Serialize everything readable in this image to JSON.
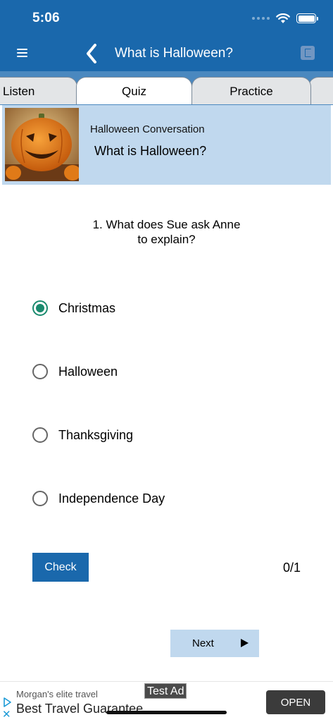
{
  "status_bar": {
    "time": "5:06"
  },
  "nav": {
    "title": "What is Halloween?",
    "icons": {
      "menu": "hamburger-menu-icon",
      "back": "chevron-left-icon",
      "bookmark": "book-icon"
    }
  },
  "tabs": [
    {
      "label": "Listen",
      "active": false
    },
    {
      "label": "Quiz",
      "active": true
    },
    {
      "label": "Practice",
      "active": false
    },
    {
      "label": "",
      "active": false
    }
  ],
  "lesson": {
    "subtitle": "Halloween Conversation",
    "title": "What is Halloween?"
  },
  "quiz": {
    "question_line1": "1. What does Sue ask Anne",
    "question_line2": "to explain?",
    "options": [
      {
        "label": "Christmas",
        "selected": true
      },
      {
        "label": "Halloween",
        "selected": false
      },
      {
        "label": "Thanksgiving",
        "selected": false
      },
      {
        "label": "Independence Day",
        "selected": false
      }
    ],
    "check_label": "Check",
    "score": "0/1",
    "next_label": "Next"
  },
  "ad": {
    "badge": "Test Ad",
    "sponsor": "Morgan's elite travel",
    "headline": "Best Travel Guarantee.",
    "cta": "OPEN"
  },
  "colors": {
    "primary": "#1a68ac",
    "light_blue": "#c0d8ee",
    "radio_selected": "#1a8a6e"
  }
}
